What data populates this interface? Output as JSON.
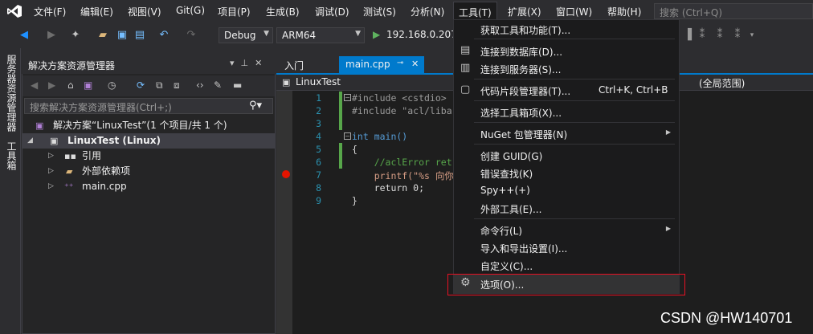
{
  "menubar": {
    "items": [
      "文件(F)",
      "编辑(E)",
      "视图(V)",
      "Git(G)",
      "项目(P)",
      "生成(B)",
      "调试(D)",
      "测试(S)",
      "分析(N)",
      "工具(T)",
      "扩展(X)",
      "窗口(W)",
      "帮助(H)"
    ],
    "search_placeholder": "搜索 (Ctrl+Q)"
  },
  "toolbar": {
    "config": "Debug",
    "platform": "ARM64",
    "run_target": "192.168.0.207"
  },
  "left_strip": {
    "tabs": [
      "服务器资源管理器",
      "工具箱"
    ]
  },
  "solution_explorer": {
    "title": "解决方案资源管理器",
    "search_placeholder": "搜索解决方案资源管理器(Ctrl+;)",
    "tree": {
      "solution": "解决方案“LinuxTest”(1 个项目/共 1 个)",
      "project": "LinuxTest (Linux)",
      "references": "引用",
      "external_deps": "外部依赖项",
      "main_file": "main.cpp"
    }
  },
  "editor": {
    "tabs": [
      "入门",
      "main.cpp"
    ],
    "nav_project": "LinuxTest",
    "nav_scope": "(全局范围)",
    "lines": [
      {
        "no": "1",
        "text": "#include <cstdio>"
      },
      {
        "no": "2",
        "text": "#include \"acl/liba"
      },
      {
        "no": "3",
        "text": ""
      },
      {
        "no": "4",
        "text": "int main()"
      },
      {
        "no": "5",
        "text": "{"
      },
      {
        "no": "6",
        "text": "    //aclError ret"
      },
      {
        "no": "7",
        "text": "    printf(\"%s 向你"
      },
      {
        "no": "8",
        "text": "    return 0;"
      },
      {
        "no": "9",
        "text": "}"
      }
    ]
  },
  "tools_menu": {
    "items": [
      {
        "label": "获取工具和功能(T)...",
        "shortcut": "",
        "submenu": false
      },
      {
        "label": "连接到数据库(D)...",
        "shortcut": "",
        "submenu": false
      },
      {
        "label": "连接到服务器(S)...",
        "shortcut": "",
        "submenu": false
      },
      {
        "label": "代码片段管理器(T)...",
        "shortcut": "Ctrl+K, Ctrl+B",
        "submenu": false
      },
      {
        "label": "选择工具箱项(X)...",
        "shortcut": "",
        "submenu": false
      },
      {
        "label": "NuGet 包管理器(N)",
        "shortcut": "",
        "submenu": true
      },
      {
        "label": "创建 GUID(G)",
        "shortcut": "",
        "submenu": false
      },
      {
        "label": "错误查找(K)",
        "shortcut": "",
        "submenu": false
      },
      {
        "label": "Spy++(+)",
        "shortcut": "",
        "submenu": false
      },
      {
        "label": "外部工具(E)...",
        "shortcut": "",
        "submenu": false
      },
      {
        "label": "命令行(L)",
        "shortcut": "",
        "submenu": true
      },
      {
        "label": "导入和导出设置(I)...",
        "shortcut": "",
        "submenu": false
      },
      {
        "label": "自定义(C)...",
        "shortcut": "",
        "submenu": false
      },
      {
        "label": "选项(O)...",
        "shortcut": "",
        "submenu": false
      }
    ]
  },
  "watermark": "CSDN @HW140701",
  "colors": {
    "accent": "#007acc",
    "highlight_box": "#e81123",
    "breakpoint": "#e51400"
  }
}
